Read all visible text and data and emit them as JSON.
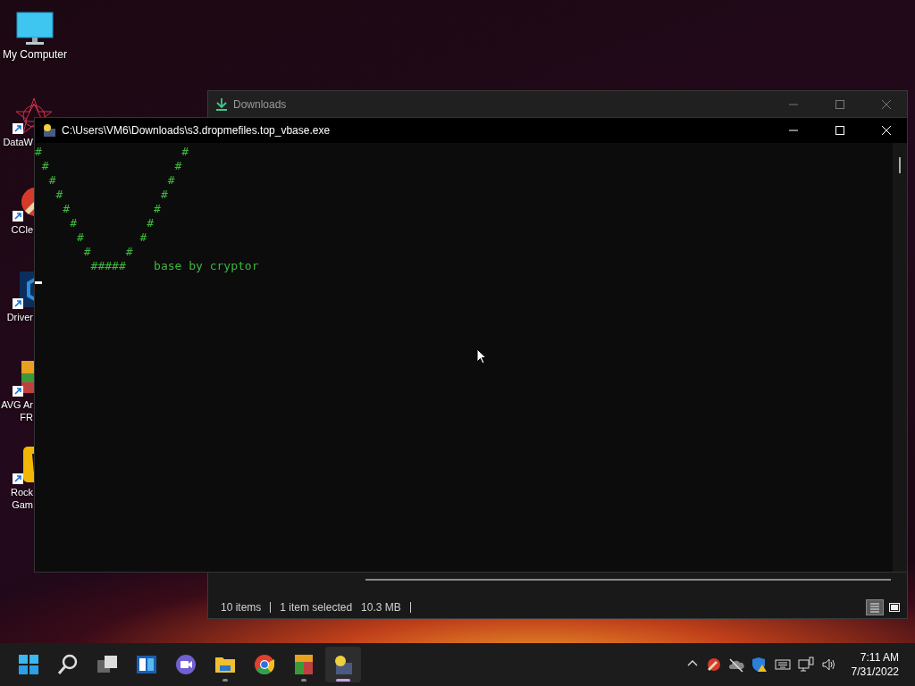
{
  "desktop_icons": [
    {
      "kind": "computer",
      "label_lines": [
        "My Computer"
      ]
    },
    {
      "kind": "star",
      "label_lines": [
        "DataW"
      ]
    },
    {
      "kind": "brush",
      "label_lines": [
        "CCle"
      ]
    },
    {
      "kind": "hexagon",
      "label_lines": [
        "Driver"
      ]
    },
    {
      "kind": "archive",
      "label_lines": [
        "AVG Ar",
        "FR"
      ]
    },
    {
      "kind": "game",
      "label_lines": [
        "Rock",
        "Gam"
      ]
    }
  ],
  "explorer_window": {
    "title": "Downloads",
    "status_items": [
      "10 items",
      "1 item selected",
      "10.3 MB"
    ],
    "view_buttons": [
      {
        "kind": "details",
        "selected": true
      },
      {
        "kind": "tiles",
        "selected": false
      }
    ]
  },
  "console_window": {
    "title": "C:\\Users\\VM6\\Downloads\\s3.dropmefiles.top_vbase.exe",
    "lines": [
      "#                    #",
      " #                  #",
      "  #                #",
      "   #              #",
      "    #            #",
      "     #          #",
      "      #        #",
      "       #     #",
      "        #####    base by cryptor"
    ]
  },
  "taskbar": {
    "apps": [
      {
        "kind": "start",
        "running": false,
        "selected": false
      },
      {
        "kind": "search",
        "running": false,
        "selected": false
      },
      {
        "kind": "taskview",
        "running": false,
        "selected": false
      },
      {
        "kind": "widgets",
        "running": false,
        "selected": false
      },
      {
        "kind": "chat",
        "running": false,
        "selected": false
      },
      {
        "kind": "folder",
        "running": true,
        "selected": false
      },
      {
        "kind": "browser",
        "running": false,
        "selected": false
      },
      {
        "kind": "archive",
        "running": true,
        "selected": false
      },
      {
        "kind": "console",
        "running": true,
        "selected": true
      }
    ],
    "tray": [
      {
        "kind": "chevron"
      },
      {
        "kind": "brush"
      },
      {
        "kind": "cloud"
      },
      {
        "kind": "shield"
      },
      {
        "kind": "keyboard"
      },
      {
        "kind": "network"
      },
      {
        "kind": "volume"
      }
    ],
    "time": "7:11 AM",
    "date": "7/31/2022"
  }
}
